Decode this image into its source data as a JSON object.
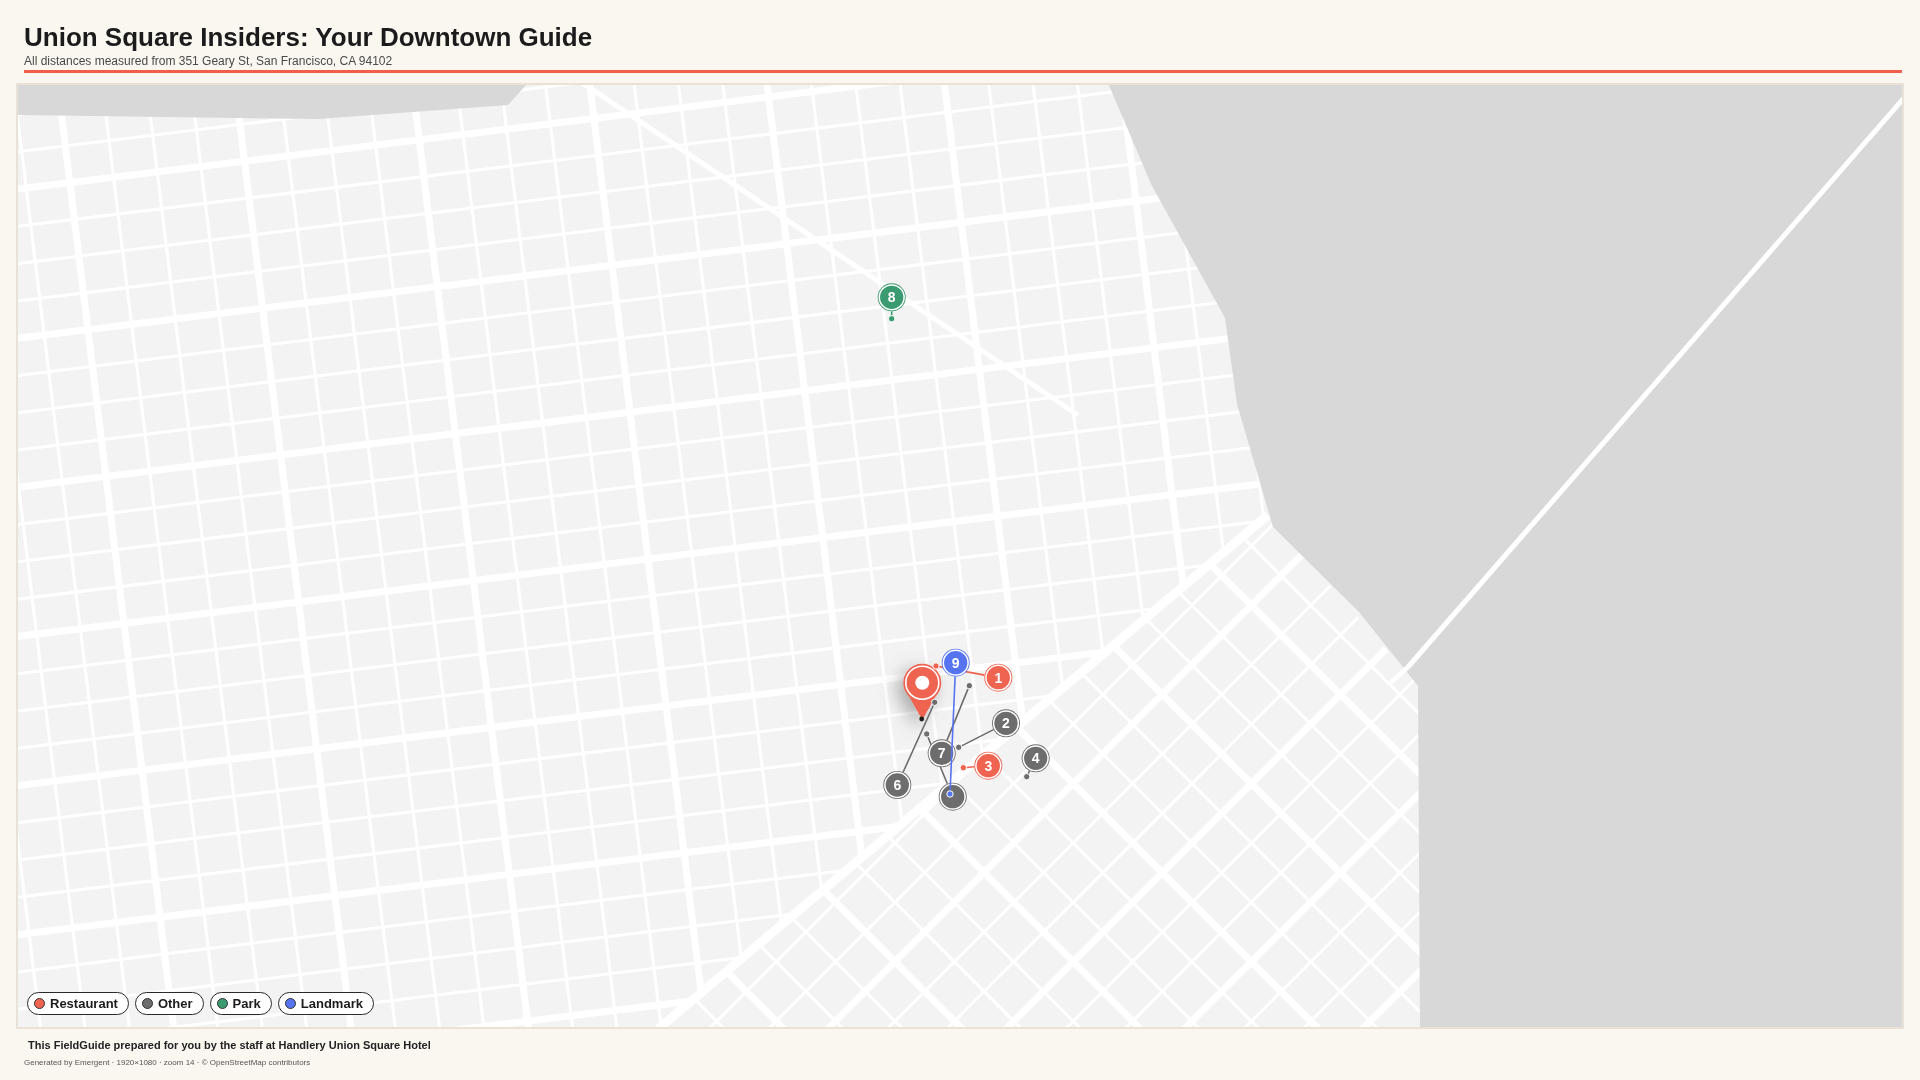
{
  "header": {
    "title": "Union Square Insiders: Your Downtown Guide",
    "subtitle": "All distances measured from 351 Geary St, San Francisco, CA 94102"
  },
  "map": {
    "markers": [
      {
        "label": "1",
        "color": "#ef6451"
      },
      {
        "label": "2",
        "color": "#6d6d6d"
      },
      {
        "label": "3",
        "color": "#ef6451"
      },
      {
        "label": "4",
        "color": "#6d6d6d"
      },
      {
        "color": "#6d6d6d"
      },
      {
        "label": "6",
        "color": "#6d6d6d"
      },
      {
        "label": "7",
        "color": "#6d6d6d"
      },
      {
        "label": "8",
        "color": "#3b9b70"
      },
      {
        "label": "9",
        "color": "#5674f0"
      }
    ],
    "legend": [
      {
        "label": "Restaurant",
        "color": "#ef6451"
      },
      {
        "label": "Other",
        "color": "#6d6d6d"
      },
      {
        "label": "Park",
        "color": "#3b9b70"
      },
      {
        "label": "Landmark",
        "color": "#5674f0"
      }
    ]
  },
  "footer": {
    "credit": "This FieldGuide prepared for you by the staff at Handlery Union Square Hotel",
    "generated": "Generated by Emergent · 1920×1080 · zoom 14 · © OpenStreetMap contributors"
  }
}
